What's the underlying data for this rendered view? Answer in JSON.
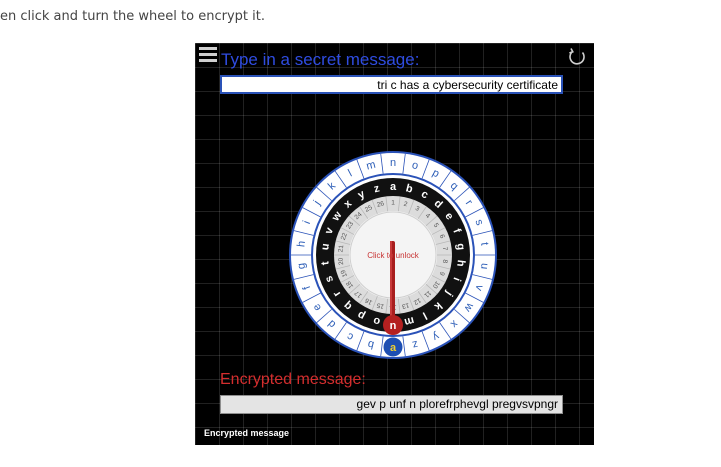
{
  "page": {
    "intro_text": "en click and turn the wheel to encrypt it."
  },
  "widget": {
    "menu_icon": "hamburger-menu-icon",
    "refresh_icon": "refresh-icon",
    "secret_label": "Type in a secret message:",
    "secret_message": "tri c has a cybersecurity certificate",
    "unlock_text": "Click to unlock",
    "encrypted_label": "Encrypted message:",
    "encrypted_message": "gev p unf n plorefrphevgl pregvsvpngr",
    "footer_label": "Encrypted message",
    "colors": {
      "background": "#000000",
      "secret_blue": "#2f4ce0",
      "encrypted_red": "#d42e2e",
      "outer_ring": "#ffffff",
      "outer_letters": "#2e5fb8",
      "middle_ring": "#111111",
      "hub_red": "#b02020",
      "pointer_blue": "#1e4fb3",
      "pointer_yellow": "#f2d12e"
    },
    "cipher": {
      "shift": 13,
      "outer_letters": [
        "a",
        "b",
        "c",
        "d",
        "e",
        "f",
        "g",
        "h",
        "i",
        "j",
        "k",
        "l",
        "m",
        "n",
        "o",
        "p",
        "q",
        "r",
        "s",
        "t",
        "u",
        "v",
        "w",
        "x",
        "y",
        "z"
      ],
      "inner_letters": [
        "n",
        "o",
        "p",
        "q",
        "r",
        "s",
        "t",
        "u",
        "v",
        "w",
        "x",
        "y",
        "z",
        "a",
        "b",
        "c",
        "d",
        "e",
        "f",
        "g",
        "h",
        "i",
        "j",
        "k",
        "l",
        "m"
      ],
      "inner_numbers": [
        "14",
        "15",
        "16",
        "17",
        "18",
        "19",
        "20",
        "21",
        "22",
        "23",
        "24",
        "25",
        "26",
        "1",
        "2",
        "3",
        "4",
        "5",
        "6",
        "7",
        "8",
        "9",
        "10",
        "11",
        "12",
        "13"
      ]
    }
  }
}
